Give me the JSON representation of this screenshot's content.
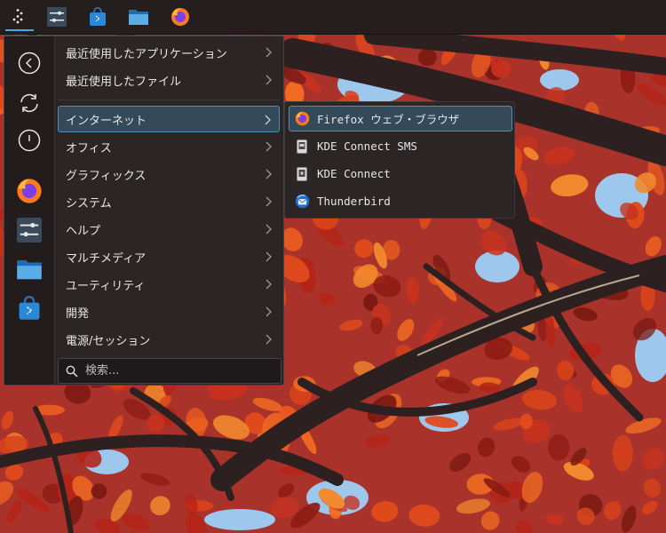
{
  "panel": {
    "apps": [
      "launcher-icon",
      "system-settings-icon",
      "discover-icon",
      "dolphin-icon",
      "firefox-icon"
    ]
  },
  "sidebar": [
    "back-icon",
    "refresh-icon",
    "power-icon",
    "firefox-icon",
    "system-settings-icon",
    "dolphin-icon",
    "discover-icon"
  ],
  "menu": {
    "recent_apps": "最近使用したアプリケーション",
    "recent_files": "最近使用したファイル",
    "categories": [
      {
        "label": "インターネット"
      },
      {
        "label": "オフィス"
      },
      {
        "label": "グラフィックス"
      },
      {
        "label": "システム"
      },
      {
        "label": "ヘルプ"
      },
      {
        "label": "マルチメディア"
      },
      {
        "label": "ユーティリティ"
      },
      {
        "label": "開発"
      },
      {
        "label": "電源/セッション"
      }
    ],
    "search_placeholder": "検索..."
  },
  "submenu": {
    "items": [
      {
        "label": "Firefox ウェブ・ブラウザ"
      },
      {
        "label": "KDE Connect SMS"
      },
      {
        "label": "KDE Connect"
      },
      {
        "label": "Thunderbird"
      }
    ]
  },
  "colors": {
    "accent": "#3daee9",
    "highlight": "#344a5b",
    "panel": "#251e1f",
    "menu": "#2b2526"
  }
}
